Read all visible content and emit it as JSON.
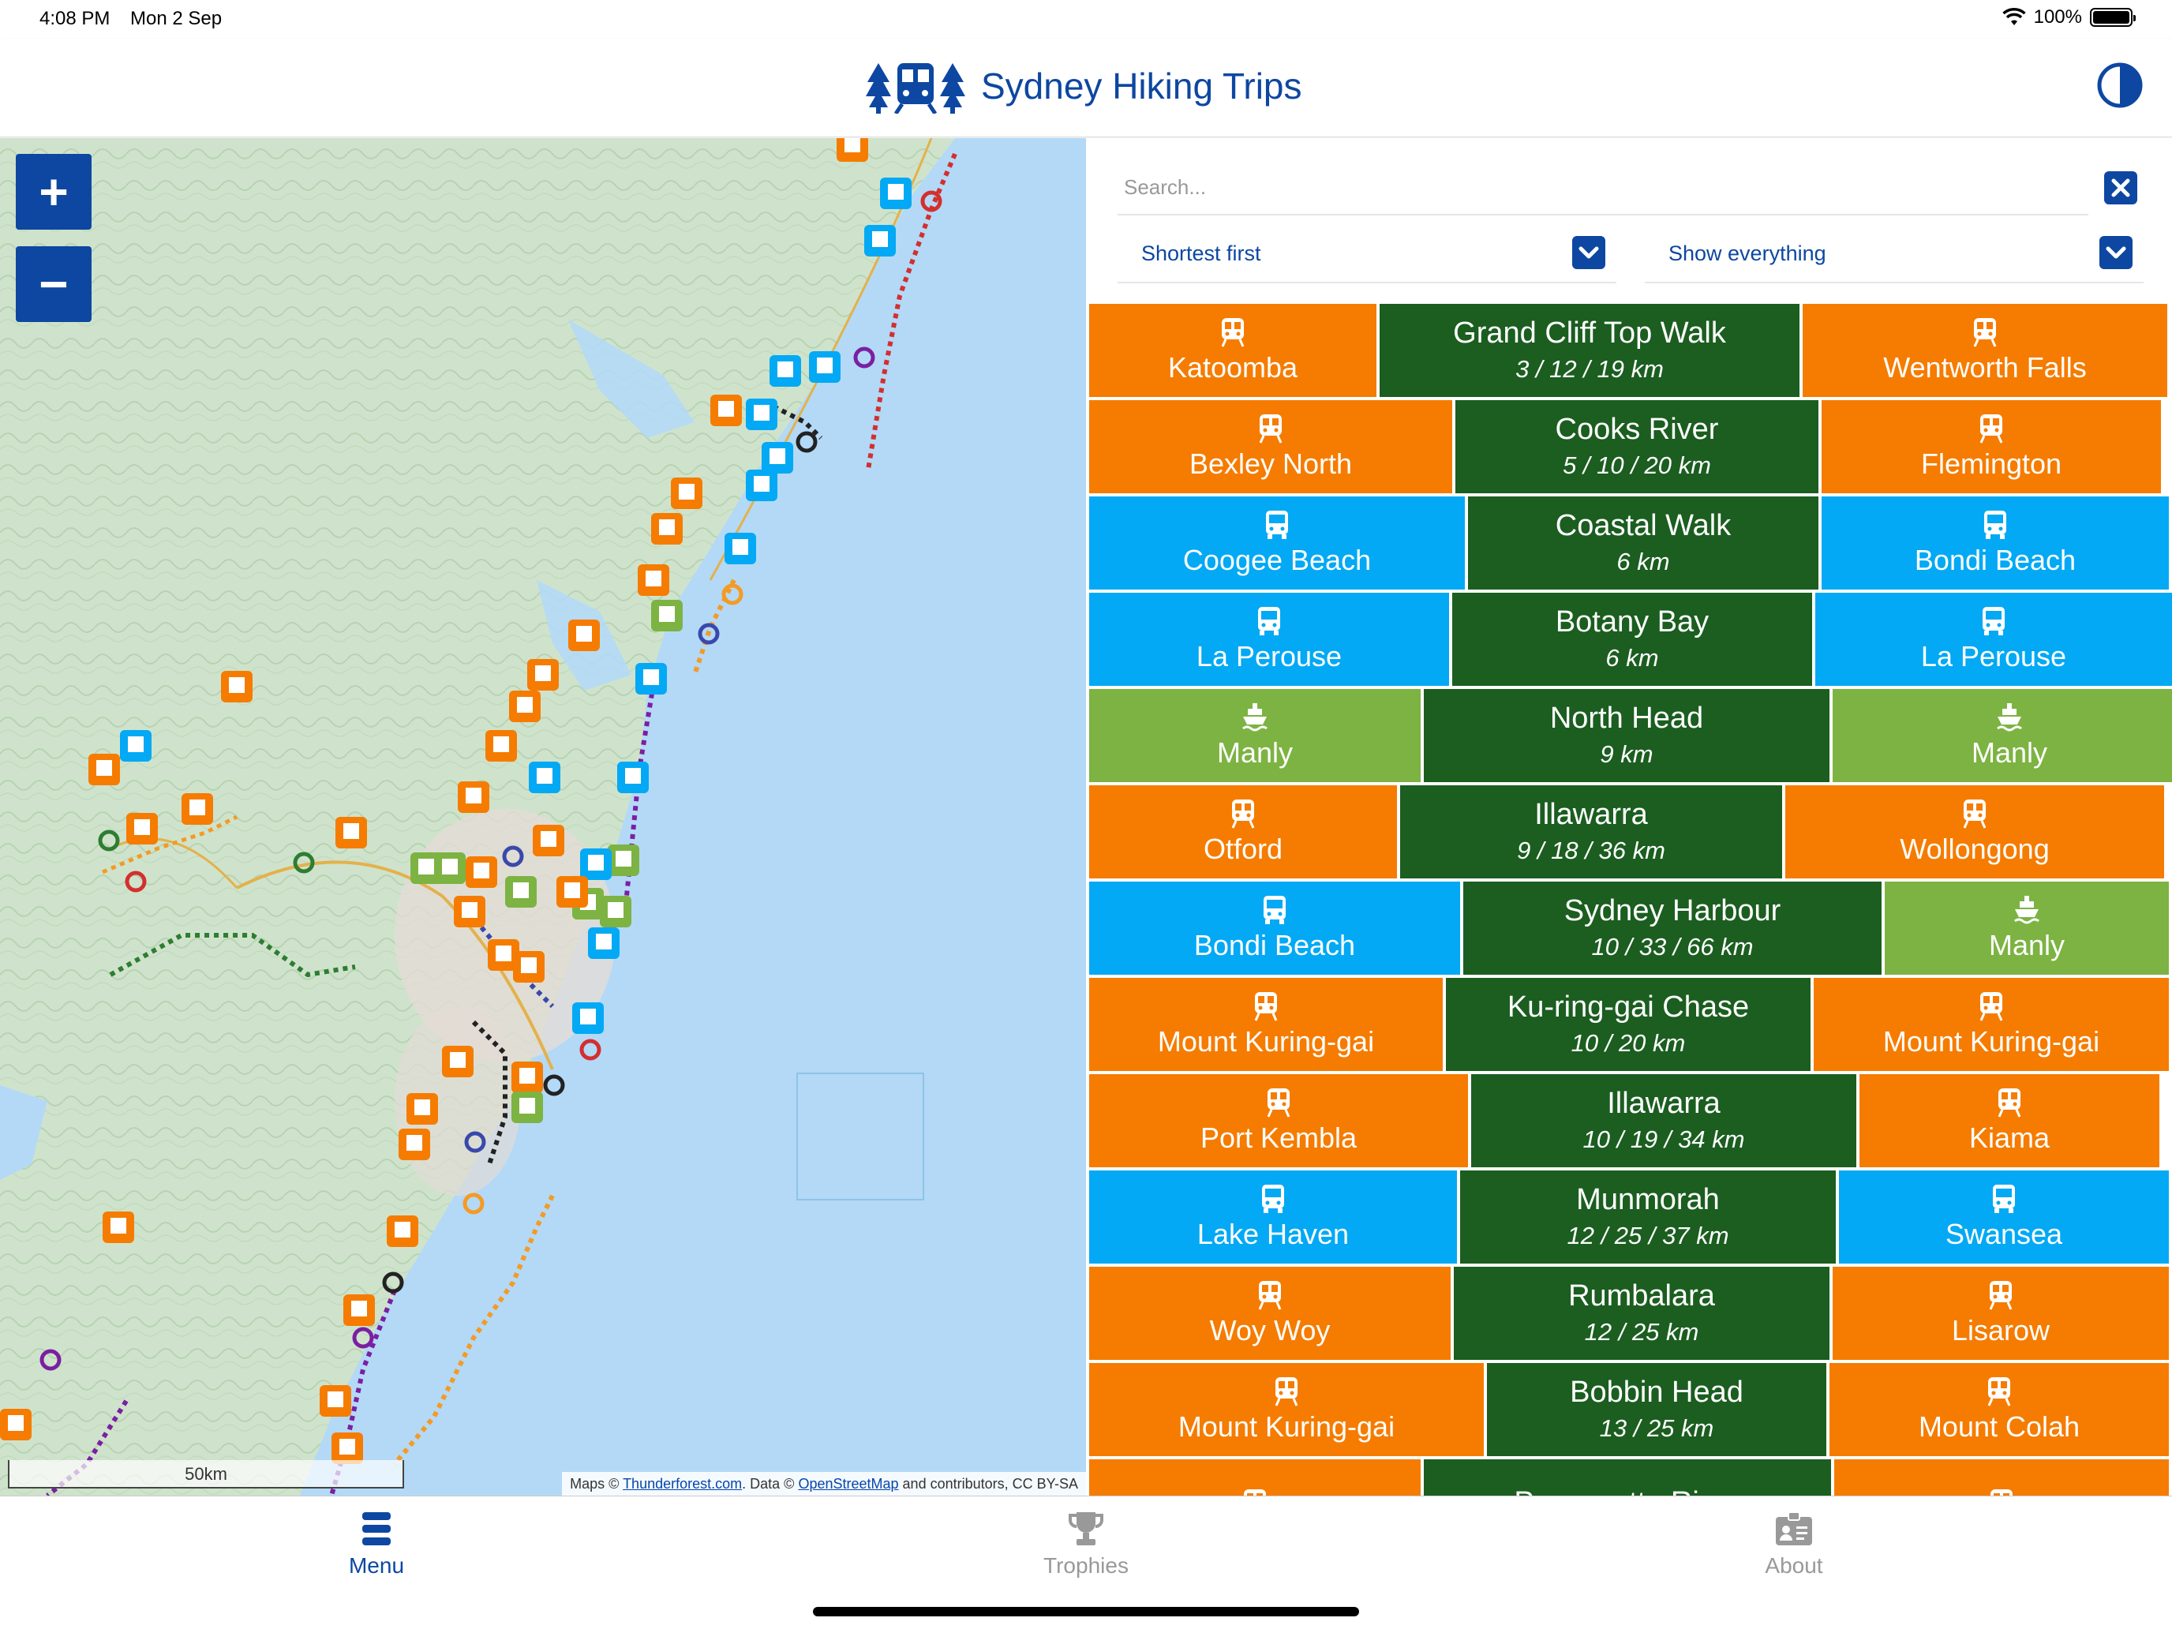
{
  "status_bar": {
    "time": "4:08 PM",
    "date": "Mon 2 Sep",
    "battery": "100%"
  },
  "header": {
    "title": "Sydney Hiking Trips"
  },
  "map": {
    "zoom_in": "+",
    "zoom_out": "−",
    "scale": "50km",
    "attribution": {
      "prefix": "Maps ©",
      "tf": "Thunderforest.com",
      "mid": ". Data ©",
      "osm": "OpenStreetMap",
      "suffix": "and contributors, CC BY-SA"
    }
  },
  "panel": {
    "search_placeholder": "Search...",
    "sort": "Shortest first",
    "filter": "Show everything"
  },
  "trips": [
    {
      "start": {
        "name": "Katoomba",
        "mode": "train"
      },
      "trail": {
        "name": "Grand Cliff Top Walk",
        "distance": "3 / 12 / 19 km"
      },
      "end": {
        "name": "Wentworth Falls",
        "mode": "train"
      }
    },
    {
      "start": {
        "name": "Bexley North",
        "mode": "train"
      },
      "trail": {
        "name": "Cooks River",
        "distance": "5 / 10 / 20 km"
      },
      "end": {
        "name": "Flemington",
        "mode": "train"
      }
    },
    {
      "start": {
        "name": "Coogee Beach",
        "mode": "bus"
      },
      "trail": {
        "name": "Coastal Walk",
        "distance": "6 km"
      },
      "end": {
        "name": "Bondi Beach",
        "mode": "bus"
      }
    },
    {
      "start": {
        "name": "La Perouse",
        "mode": "bus"
      },
      "trail": {
        "name": "Botany Bay",
        "distance": "6 km"
      },
      "end": {
        "name": "La Perouse",
        "mode": "bus"
      }
    },
    {
      "start": {
        "name": "Manly",
        "mode": "ferry"
      },
      "trail": {
        "name": "North Head",
        "distance": "9 km"
      },
      "end": {
        "name": "Manly",
        "mode": "ferry"
      }
    },
    {
      "start": {
        "name": "Otford",
        "mode": "train"
      },
      "trail": {
        "name": "Illawarra",
        "distance": "9 / 18 / 36 km"
      },
      "end": {
        "name": "Wollongong",
        "mode": "train"
      }
    },
    {
      "start": {
        "name": "Bondi Beach",
        "mode": "bus"
      },
      "trail": {
        "name": "Sydney Harbour",
        "distance": "10 / 33 / 66 km"
      },
      "end": {
        "name": "Manly",
        "mode": "ferry"
      }
    },
    {
      "start": {
        "name": "Mount Kuring-gai",
        "mode": "train"
      },
      "trail": {
        "name": "Ku-ring-gai Chase",
        "distance": "10 / 20 km"
      },
      "end": {
        "name": "Mount Kuring-gai",
        "mode": "train"
      }
    },
    {
      "start": {
        "name": "Port Kembla",
        "mode": "train"
      },
      "trail": {
        "name": "Illawarra",
        "distance": "10 / 19 / 34 km"
      },
      "end": {
        "name": "Kiama",
        "mode": "train"
      }
    },
    {
      "start": {
        "name": "Lake Haven",
        "mode": "bus"
      },
      "trail": {
        "name": "Munmorah",
        "distance": "12 / 25 / 37 km"
      },
      "end": {
        "name": "Swansea",
        "mode": "bus"
      }
    },
    {
      "start": {
        "name": "Woy Woy",
        "mode": "train"
      },
      "trail": {
        "name": "Rumbalara",
        "distance": "12 / 25 km"
      },
      "end": {
        "name": "Lisarow",
        "mode": "train"
      }
    },
    {
      "start": {
        "name": "Mount Kuring-gai",
        "mode": "train"
      },
      "trail": {
        "name": "Bobbin Head",
        "distance": "13 / 25 km"
      },
      "end": {
        "name": "Mount Colah",
        "mode": "train"
      }
    },
    {
      "start": {
        "name": "",
        "mode": "train"
      },
      "trail": {
        "name": "Parramatta River",
        "distance": ""
      },
      "end": {
        "name": "",
        "mode": "train"
      }
    }
  ],
  "tabs": [
    {
      "label": "Menu",
      "icon": "menu-icon",
      "active": true
    },
    {
      "label": "Trophies",
      "icon": "trophy-icon",
      "active": false
    },
    {
      "label": "About",
      "icon": "about-icon",
      "active": false
    }
  ],
  "colors": {
    "primary": "#0d47a1",
    "train": "#f57c00",
    "bus": "#03a9f4",
    "ferry": "#7cb342",
    "trail": "#1b5e20"
  }
}
